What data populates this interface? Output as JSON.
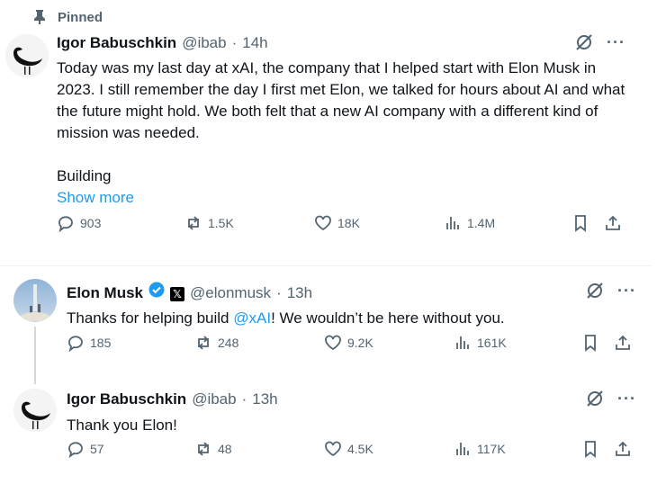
{
  "pinned": {
    "label": "Pinned",
    "icon": "pin-icon"
  },
  "tweet1": {
    "name": "Igor Babuschkin",
    "handle": "@ibab",
    "sep": "·",
    "time": "14h",
    "text": "Today was my last day at xAI, the company that I helped start with Elon Musk in 2023. I still remember the day I first met Elon, we talked for hours about AI and what the future might hold. We both felt that a new AI company with a different kind of mission was needed.",
    "text2": "Building",
    "show_more": "Show more",
    "replies": "903",
    "reposts": "1.5K",
    "likes": "18K",
    "views": "1.4M"
  },
  "tweet2": {
    "name": "Elon Musk",
    "handle": "@elonmusk",
    "sep": "·",
    "time": "13h",
    "text_before": "Thanks for helping build ",
    "mention": "@xAI",
    "text_after": "! We wouldn’t be here without you.",
    "replies": "185",
    "reposts": "248",
    "likes": "9.2K",
    "views": "161K",
    "badge_x": "𝕏"
  },
  "tweet3": {
    "name": "Igor Babuschkin",
    "handle": "@ibab",
    "sep": "·",
    "time": "13h",
    "text": "Thank you Elon!",
    "replies": "57",
    "reposts": "48",
    "likes": "4.5K",
    "views": "117K"
  },
  "colors": {
    "accent": "#1d9bf0",
    "secondary": "#536471",
    "text": "#0f1419",
    "divider": "#eff3f4"
  }
}
